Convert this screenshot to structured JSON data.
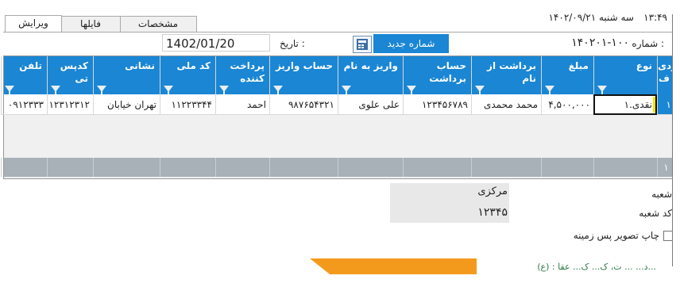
{
  "status": {
    "time": "۱۳:۴۹",
    "date": "سه شنبه  ۱۴۰۲/۰۹/۲۱"
  },
  "tabs": [
    {
      "label": "ویرایش",
      "active": true
    },
    {
      "label": "فایلها",
      "active": false
    },
    {
      "label": "مشخصات",
      "active": false
    }
  ],
  "form": {
    "number_label": "شماره :",
    "number_value": "۱۴۰۲۰۱-۱۰۰",
    "new_number_button": "شماره جدید",
    "date_label": "تاریخ :",
    "date_value": "1402/01/20",
    "calendar_icon_text": "12"
  },
  "grid": {
    "headers": [
      "ردی ف",
      "نوع",
      "مبلغ",
      "برداشت از نام",
      "حساب برداشت",
      "واریز به نام",
      "حساب واریز",
      "پرداخت کننده",
      "کد ملی",
      "نشانی",
      "کدپس تی",
      "تلفن"
    ],
    "row": [
      "۱",
      "۱.نقدی",
      "۴,۵۰۰,۰۰۰",
      "محمد محمدی",
      "۱۲۳۴۵۶۷۸۹",
      "علی علوی",
      "۹۸۷۶۵۴۳۲۱",
      "احمد",
      "۱۱۲۲۳۳۴۴",
      "تهران خیابان",
      "۱۲۳۱۲۳۱۲",
      "۰۹۱۲۳۳۳"
    ],
    "total_row_label": "۱"
  },
  "detail": {
    "branch_label": "شعبه",
    "branch_value": "مرکزی",
    "branch_code_label": "کد شعبه",
    "branch_code_value": "۱۲۳۴۵",
    "bg_print_label": "چاپ تصویر پس زمینه",
    "bg_print_checked": false
  },
  "bottom": {
    "text": "(ع) : د... ... ت، ک... ک... عقا..."
  },
  "colors": {
    "header_blue": "#1a86d4",
    "total_gray": "#a8b0b8",
    "accent_orange": "#f39a1d"
  }
}
